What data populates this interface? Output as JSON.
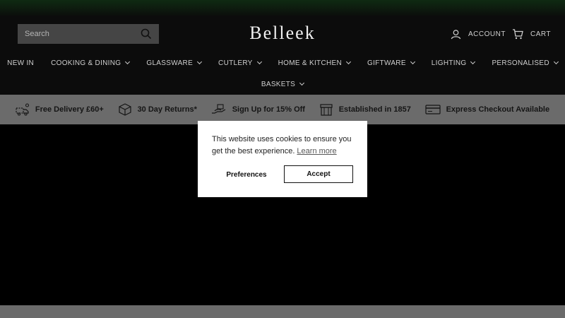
{
  "header": {
    "search_placeholder": "Search",
    "logo_text": "Belleek",
    "account_label": "ACCOUNT",
    "cart_label": "CART"
  },
  "nav": {
    "row1": [
      "NEW IN",
      "COOKING & DINING",
      "GLASSWARE",
      "CUTLERY",
      "HOME & KITCHEN",
      "GIFTWARE",
      "LIGHTING",
      "PERSONALISED"
    ],
    "row2": [
      "BASKETS"
    ]
  },
  "benefits": [
    {
      "icon": "delivery-truck-icon",
      "label": "Free Delivery £60+"
    },
    {
      "icon": "returns-box-icon",
      "label": "30 Day Returns*"
    },
    {
      "icon": "signup-hand-icon",
      "label": "Sign Up for 15% Off"
    },
    {
      "icon": "storefront-icon",
      "label": "Established in 1857"
    },
    {
      "icon": "credit-card-icon",
      "label": "Express Checkout Available"
    }
  ],
  "cookie": {
    "message": "This website uses cookies to ensure you get the best experience.",
    "learn_more": "Learn more",
    "preferences": "Preferences",
    "accept": "Accept"
  },
  "colors": {
    "header_bg": "#0c0c0c",
    "benefits_bg": "#6b6b6b",
    "modal_bg": "#ffffff"
  }
}
